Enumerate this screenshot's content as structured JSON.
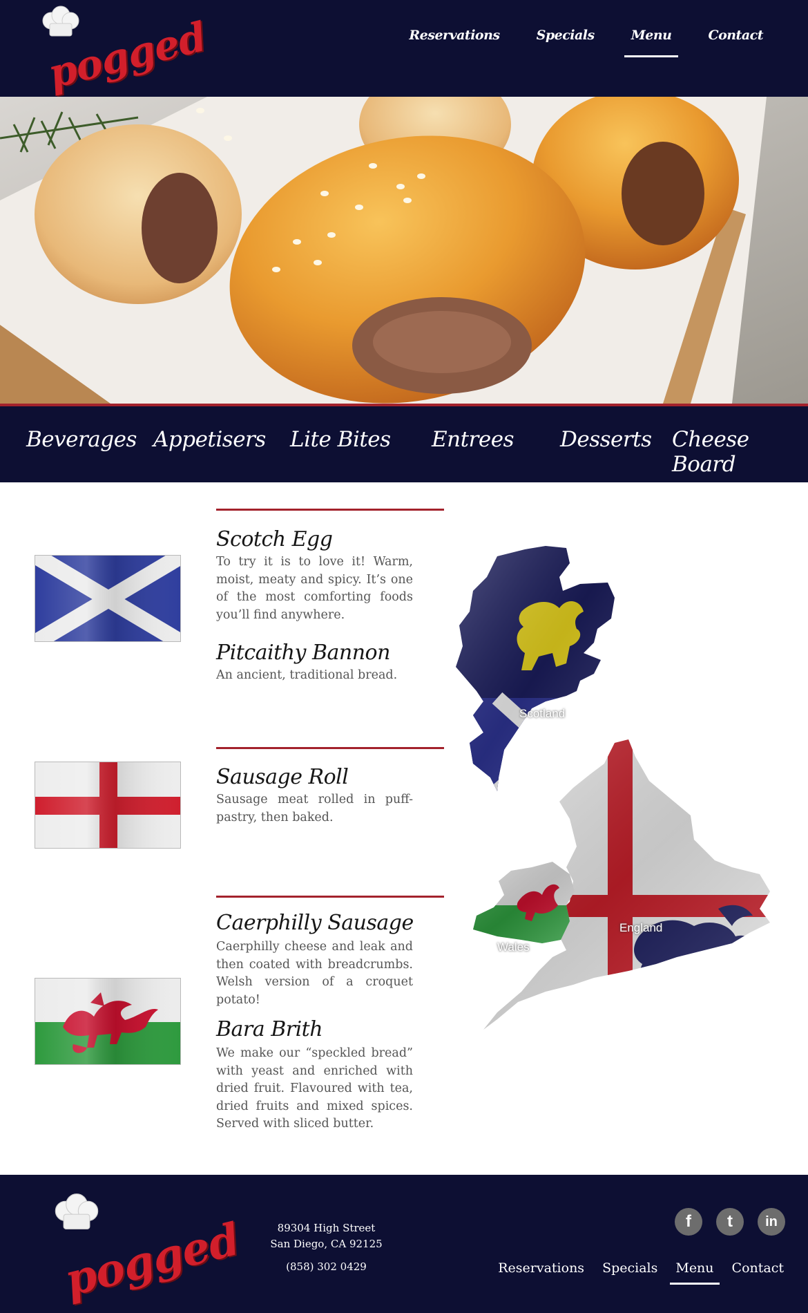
{
  "brand": {
    "logo_text": "pogged",
    "accent": "#d21f2b",
    "navy": "#0d0f33",
    "divider": "#a3222c"
  },
  "top_nav": [
    {
      "label": "Reservations",
      "active": false
    },
    {
      "label": "Specials",
      "active": false
    },
    {
      "label": "Menu",
      "active": true
    },
    {
      "label": "Contact",
      "active": false
    }
  ],
  "categories": [
    "Beverages",
    "Appetisers",
    "Lite Bites",
    "Entrees",
    "Desserts",
    "Cheese Board"
  ],
  "sections": [
    {
      "flag": "scotland-flag",
      "dishes": [
        {
          "name": "Scotch Egg",
          "desc": "To try it is to love it!  Warm, moist, meaty and spicy.  It’s one of the most comforting foods you’ll find anywhere."
        },
        {
          "name": "Pitcaithy Bannon",
          "desc": "An ancient, traditional bread."
        }
      ]
    },
    {
      "flag": "england-flag",
      "dishes": [
        {
          "name": "Sausage Roll",
          "desc": "Sausage meat rolled in puff-pastry, then baked."
        }
      ]
    },
    {
      "flag": "wales-flag",
      "dishes": [
        {
          "name": "Caerphilly Sausage",
          "desc": "Caerphilly cheese and leak and then coated with breadcrumbs. Welsh version of a croquet potato!"
        },
        {
          "name": "Bara Brith",
          "desc": "We make our “speckled bread” with yeast and enriched with dried fruit. Flavoured with tea, dried fruits and mixed spices.  Served with sliced butter."
        }
      ]
    }
  ],
  "map": {
    "labels": {
      "scotland": "Scotland",
      "england": "England",
      "wales": "Wales"
    }
  },
  "footer": {
    "address_line1": "89304 High Street",
    "address_line2": "San Diego, CA 92125",
    "phone": "(858) 302 0429",
    "socials": [
      {
        "icon": "facebook-icon",
        "glyph": "f"
      },
      {
        "icon": "twitter-icon",
        "glyph": "t"
      },
      {
        "icon": "linkedin-icon",
        "glyph": "in"
      }
    ],
    "nav": [
      {
        "label": "Reservations",
        "active": false
      },
      {
        "label": "Specials",
        "active": false
      },
      {
        "label": "Menu",
        "active": true
      },
      {
        "label": "Contact",
        "active": false
      }
    ]
  }
}
